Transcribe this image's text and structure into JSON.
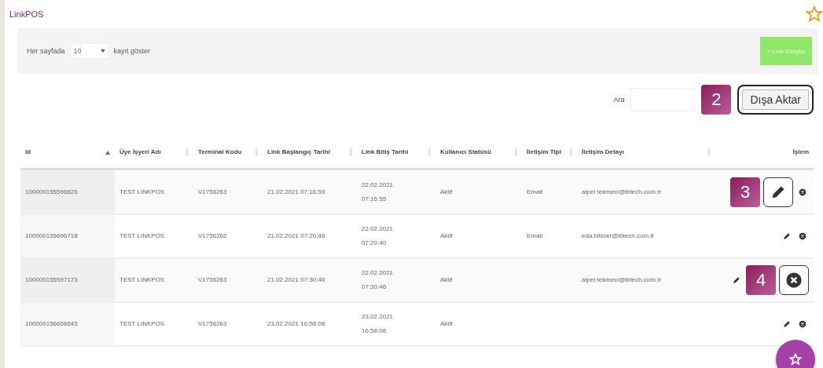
{
  "title": "LinkPOS",
  "page_size": {
    "prefix": "Her sayfada",
    "value": "10",
    "suffix": "kayıt göster"
  },
  "create_button": {
    "label": "+ Link Oluştur"
  },
  "search": {
    "label": "Ara"
  },
  "export_button": {
    "label": "Dışa Aktar",
    "highlighted": true,
    "callout": "2"
  },
  "table": {
    "columns": [
      {
        "label": "Id",
        "sorted": true
      },
      {
        "label": "Üye İşyeri Adı",
        "sorted": false
      },
      {
        "label": "Terminal Kodu",
        "sorted": false
      },
      {
        "label": "Link Başlangıç Tarihi",
        "sorted": false
      },
      {
        "label": "Link Bitiş Tarihi",
        "sorted": false
      },
      {
        "label": "Kullanıcı Statüsü",
        "sorted": false
      },
      {
        "label": "İletişim Tipi",
        "sorted": false
      },
      {
        "label": "İletişim Detayı",
        "sorted": false
      },
      {
        "label": "İşlem",
        "sorted": false
      }
    ],
    "rows": [
      {
        "cells": [
          "100000155596626",
          "TEST LINKPOS",
          "V1756263",
          "21.02.2021 07:16:59",
          "22.02.2021 07:16:55",
          "Aktif",
          "Email",
          "alper.tekmeci@ibtech.com.tr"
        ],
        "actions": [
          {
            "kind": "edit",
            "highlighted": true,
            "callout": "3"
          },
          {
            "kind": "delete",
            "highlighted": false
          }
        ]
      },
      {
        "cells": [
          "100000155696718",
          "TEST LINKPOS",
          "V1756262",
          "21.02.2021 07:20:48",
          "22.02.2021 07:20:40",
          "Aktif",
          "Email",
          "eda.bilicier@ibtech.com.tr"
        ],
        "actions": [
          {
            "kind": "edit",
            "highlighted": false
          },
          {
            "kind": "delete",
            "highlighted": false
          }
        ]
      },
      {
        "cells": [
          "100000155597173",
          "TEST LINKPOS",
          "V1756263",
          "21.02.2021 07:30:46",
          "22.02.2021 07:30:46",
          "Aktif",
          "",
          "alper.tekmeci@ibtech.com.tr"
        ],
        "actions": [
          {
            "kind": "edit",
            "highlighted": false
          },
          {
            "kind": "delete",
            "highlighted": true,
            "callout": "4"
          }
        ]
      },
      {
        "cells": [
          "100000156656645",
          "TEST LINKPOS",
          "V1756263",
          "23.02.2021 16:58:08",
          "23.02.2021 16:58:08",
          "Aktif",
          "",
          ""
        ],
        "actions": [
          {
            "kind": "edit",
            "highlighted": false
          },
          {
            "kind": "delete",
            "highlighted": false
          }
        ]
      }
    ]
  }
}
